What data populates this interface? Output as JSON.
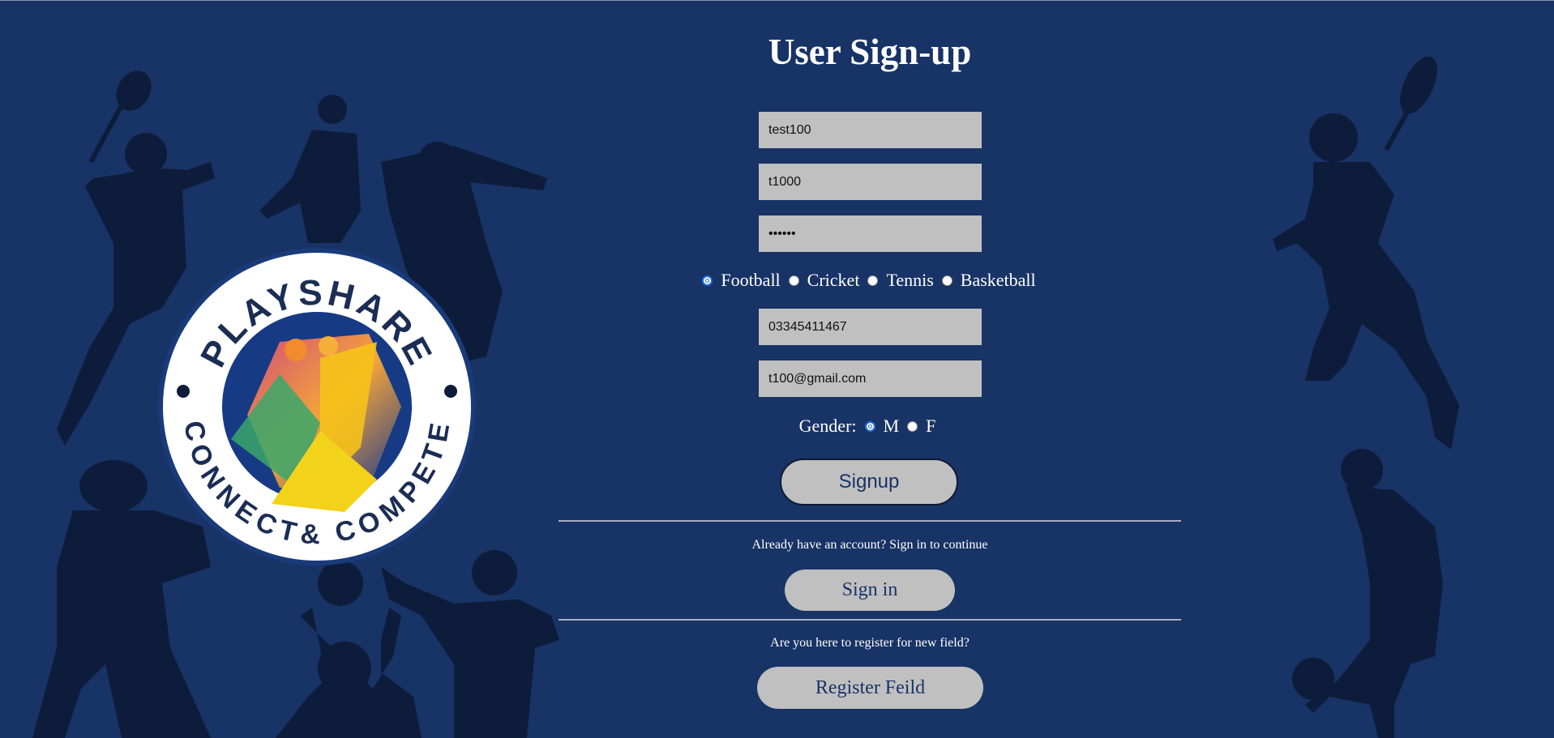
{
  "page": {
    "title": "User Sign-up"
  },
  "form": {
    "username_value": "test100",
    "name_value": "t1000",
    "password_value": "••••••",
    "sports": [
      {
        "label": "Football",
        "checked": true
      },
      {
        "label": "Cricket",
        "checked": false
      },
      {
        "label": "Tennis",
        "checked": false
      },
      {
        "label": "Basketball",
        "checked": false
      }
    ],
    "phone_value": "03345411467",
    "email_value": "t100@gmail.com",
    "gender_label": "Gender:",
    "genders": [
      {
        "label": "M",
        "checked": true
      },
      {
        "label": "F",
        "checked": false
      }
    ],
    "signup_label": "Signup"
  },
  "signin_section": {
    "prompt": "Already have an account? Sign in to continue",
    "button_label": "Sign in"
  },
  "register_section": {
    "prompt": "Are you here to register for new field?",
    "button_label": "Register Feild"
  },
  "logo": {
    "top_text": "PLAYSHARE",
    "bottom_text": "CONNECT& COMPETE"
  },
  "colors": {
    "background": "#183366",
    "field": "#c0c0c0",
    "silhouette": "#0e1c3c"
  }
}
